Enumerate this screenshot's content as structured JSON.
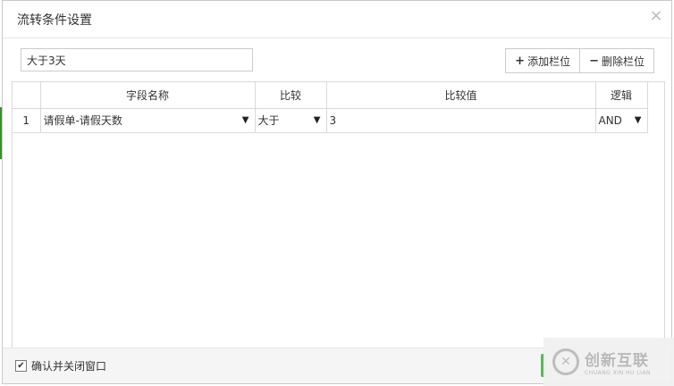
{
  "dialog": {
    "title": "流转条件设置",
    "close_glyph": "×"
  },
  "toolbar": {
    "name_value": "大于3天",
    "add_glyph": "+",
    "add_label": "添加栏位",
    "delete_glyph": "−",
    "delete_label": "删除栏位"
  },
  "grid": {
    "columns": [
      "",
      "字段名称",
      "比较",
      "比较值",
      "逻辑"
    ],
    "rows": [
      {
        "num": "1",
        "field": "请假单-请假天数",
        "compare": "大于",
        "value": "3",
        "logic": "AND"
      }
    ]
  },
  "footer": {
    "checkbox_label": "确认并关闭窗口",
    "checked_glyph": "✔"
  },
  "watermark": {
    "cn": "创新互联",
    "en": "CHUANG XIN HU LIAN"
  },
  "colors": {
    "accent_green": "#5cb85c"
  }
}
